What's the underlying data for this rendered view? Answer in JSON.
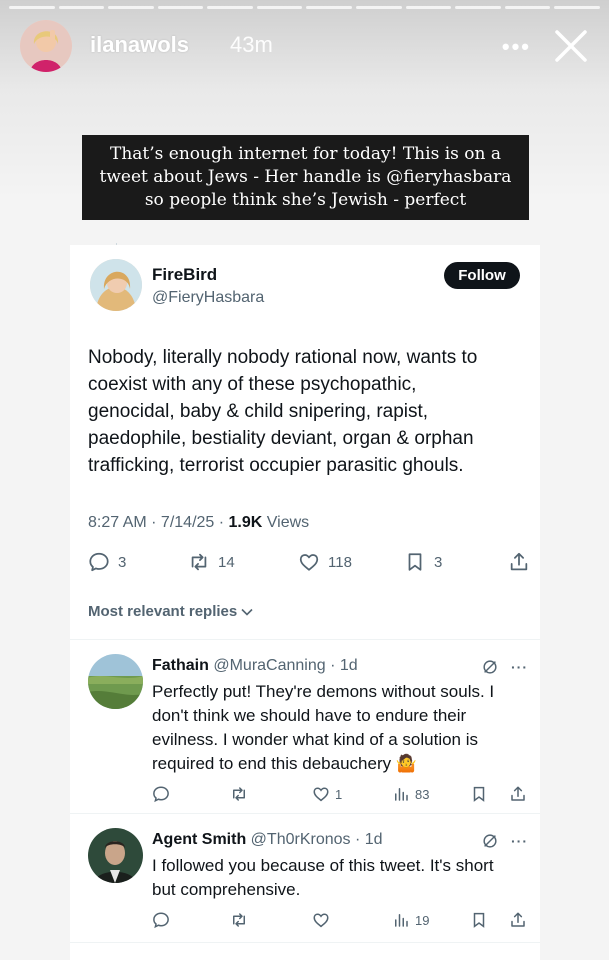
{
  "story": {
    "username": "ilanawols",
    "time_ago": "43m",
    "more_label": "•••",
    "caption_lines": [
      "That’s enough internet for today!  This is on a",
      "tweet about Jews - Her handle is @fieryhasbara",
      "so people think she’s Jewish - perfect"
    ]
  },
  "post": {
    "name": "FireBird",
    "handle": "@FieryHasbara",
    "follow_label": "Follow",
    "text_lines": [
      "Nobody, literally nobody rational now, wants to",
      "coexist with any of these psychopathic,",
      "genocidal, baby & child snipering, rapist,",
      "paedophile, bestiality deviant, organ & orphan",
      "trafficking, terrorist occupier parasitic ghouls."
    ],
    "time": "8:27 AM",
    "date": "7/14/25",
    "views": "1.9K",
    "views_label": "Views",
    "replies": "3",
    "reposts": "14",
    "likes": "118",
    "bookmarks": "3"
  },
  "replies_sort_label": "Most relevant replies",
  "replies": [
    {
      "name": "Fathain",
      "handle": "@MuraCanning",
      "age": "1d",
      "text_lines": [
        "Perfectly put! They're demons without souls. I",
        "don't think we should have to endure their",
        "evilness. I wonder what kind of a solution is",
        "required to end this debauchery 🤷"
      ],
      "likes": "1",
      "views": "83"
    },
    {
      "name": "Agent Smith",
      "handle": "@Th0rKronos",
      "age": "1d",
      "text_lines": [
        "I followed you because of this tweet. It's short",
        "but comprehensive."
      ],
      "likes": "",
      "views": "19"
    }
  ],
  "colors": {
    "text_primary": "#0f1419",
    "text_secondary": "#536471",
    "follow_bg": "#0f1419",
    "banner_bg": "#1a1a1a"
  }
}
